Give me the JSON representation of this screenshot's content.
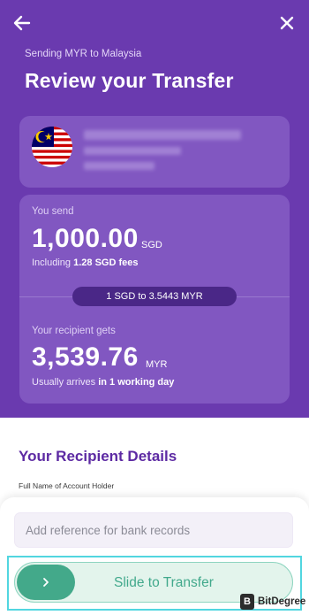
{
  "header": {
    "subtitle": "Sending MYR to Malaysia",
    "title": "Review your Transfer",
    "back_icon": "back-arrow-icon",
    "close_icon": "close-icon"
  },
  "recipient": {
    "flag": "malaysia-flag-icon"
  },
  "send": {
    "label": "You send",
    "amount": "1,000.00",
    "currency": "SGD",
    "fees_prefix": "Including",
    "fees_value": "1.28 SGD fees"
  },
  "rate": {
    "text": "1 SGD to 3.5443 MYR"
  },
  "receive": {
    "label": "Your recipient gets",
    "amount": "3,539.76",
    "currency": "MYR",
    "arrival_prefix": "Usually arrives",
    "arrival_value": "in 1 working day"
  },
  "details": {
    "section_title": "Your Recipient Details",
    "field_label": "Full Name of Account Holder"
  },
  "footer": {
    "reference_placeholder": "Add reference for bank records",
    "slide_label": "Slide to Transfer",
    "slide_icon": "chevron-right-icon"
  },
  "watermark": {
    "logo": "B",
    "text": "BitDegree"
  },
  "colors": {
    "hero_bg": "#6a3aaf",
    "card_bg": "#8157c1",
    "rate_pill": "#4a2787",
    "section_title": "#5d2aa3",
    "slider_bg": "#e3f4ec",
    "slider_knob": "#43a98a",
    "highlight_outline": "#52d6e0"
  }
}
